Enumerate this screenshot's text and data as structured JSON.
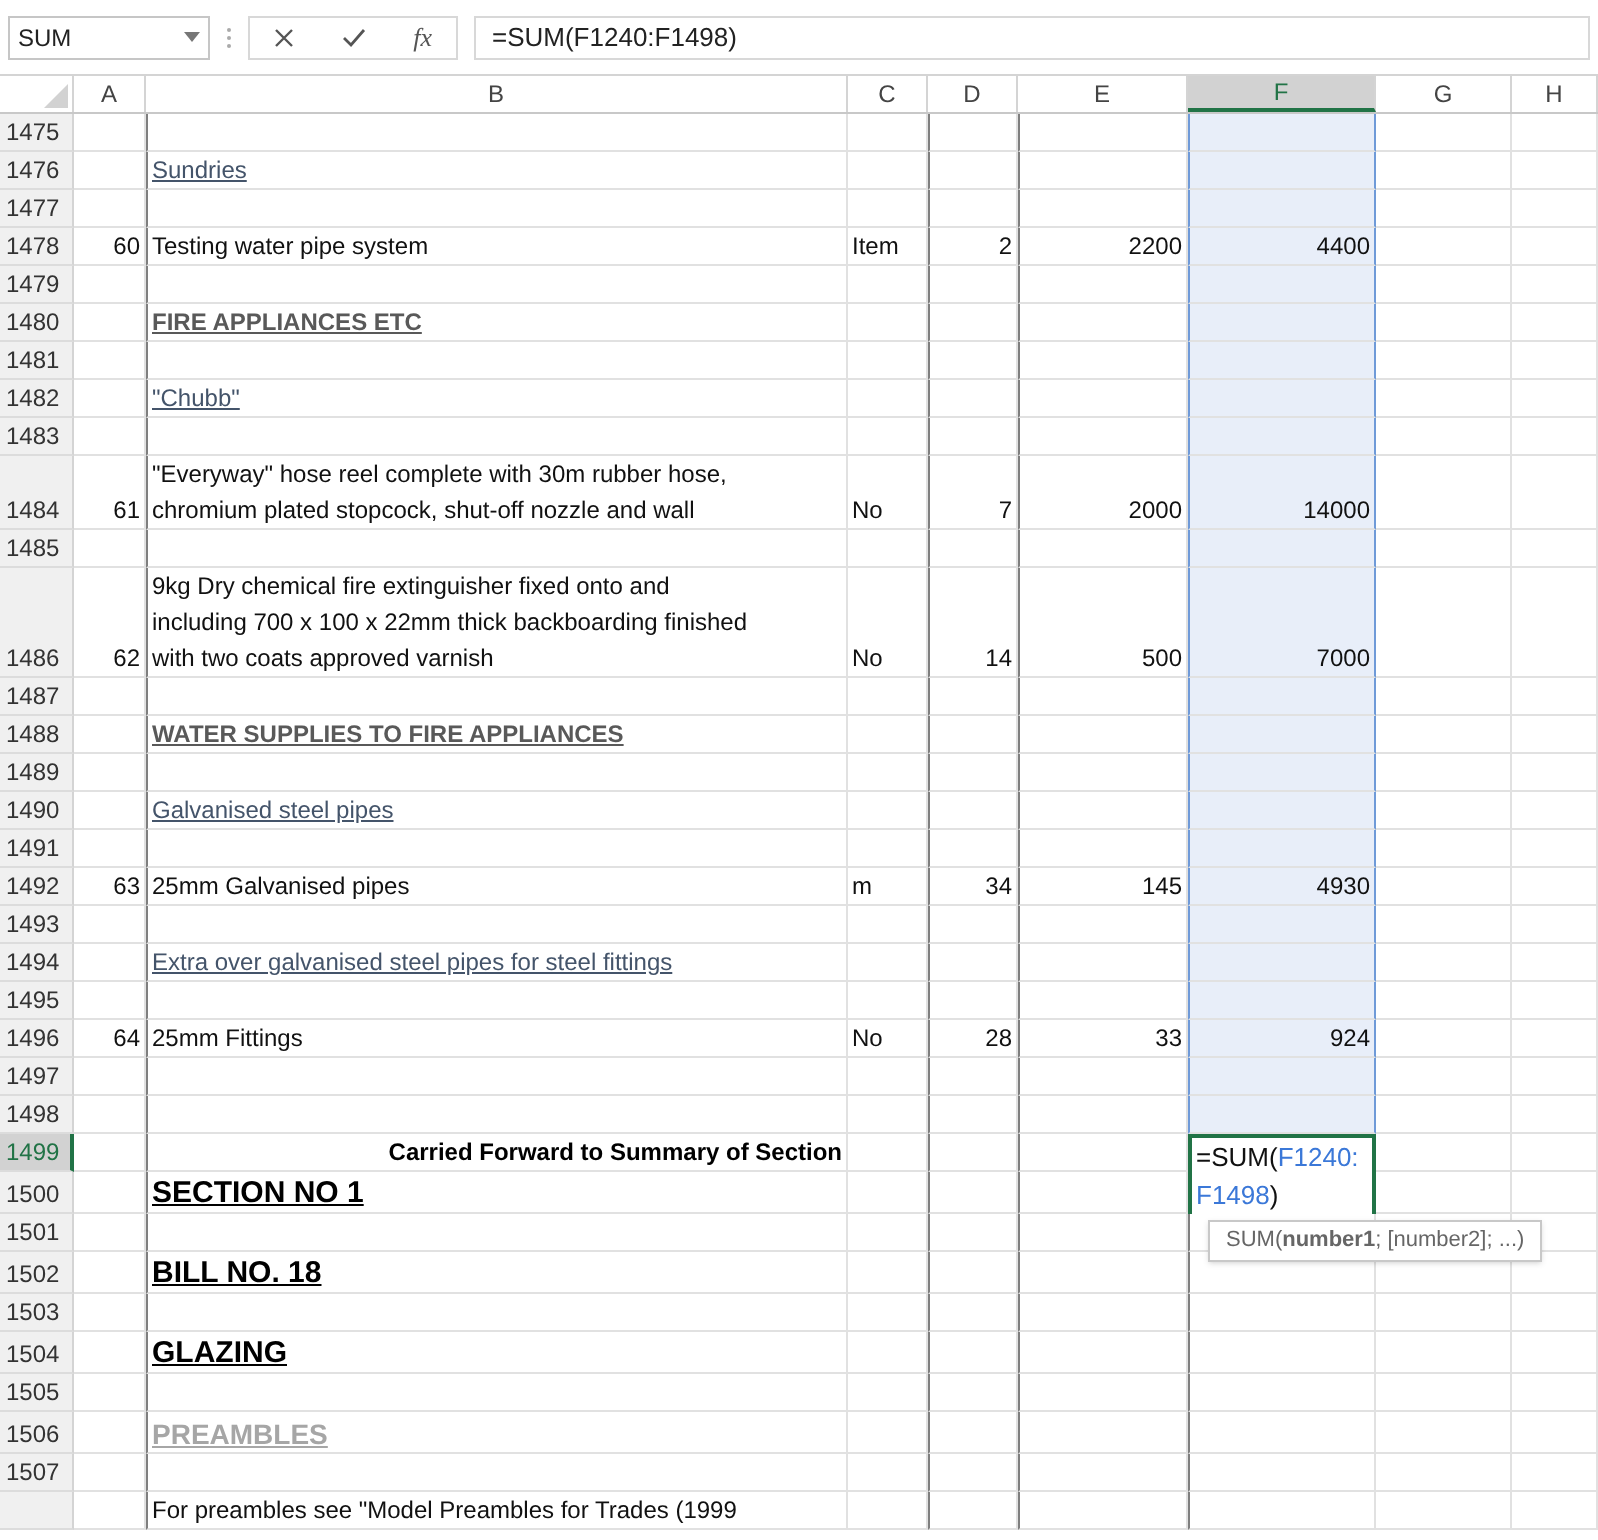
{
  "name_box": "SUM",
  "function_label": "fx",
  "formula": "=SUM(F1240:F1498)",
  "columns": [
    {
      "label": "A",
      "selected": false
    },
    {
      "label": "B",
      "selected": false
    },
    {
      "label": "C",
      "selected": false
    },
    {
      "label": "D",
      "selected": false
    },
    {
      "label": "E",
      "selected": false
    },
    {
      "label": "F",
      "selected": true
    },
    {
      "label": "G",
      "selected": false
    },
    {
      "label": "H",
      "selected": false
    }
  ],
  "rows": [
    {
      "number": "1475",
      "selected": false,
      "in_range": true,
      "kind": "plain"
    },
    {
      "number": "1476",
      "selected": false,
      "in_range": true,
      "kind": "subheading",
      "b": "Sundries"
    },
    {
      "number": "1477",
      "selected": false,
      "in_range": true,
      "kind": "plain"
    },
    {
      "number": "1478",
      "selected": false,
      "in_range": true,
      "kind": "plain",
      "a": "60",
      "b": "Testing water pipe system",
      "c": "Item",
      "d": "2",
      "e": "2200",
      "f": "4400"
    },
    {
      "number": "1479",
      "selected": false,
      "in_range": true,
      "kind": "plain"
    },
    {
      "number": "1480",
      "selected": false,
      "in_range": true,
      "kind": "heading",
      "b": "FIRE APPLIANCES ETC"
    },
    {
      "number": "1481",
      "selected": false,
      "in_range": true,
      "kind": "plain"
    },
    {
      "number": "1482",
      "selected": false,
      "in_range": true,
      "kind": "subheading",
      "b": "\"Chubb\""
    },
    {
      "number": "1483",
      "selected": false,
      "in_range": true,
      "kind": "plain"
    },
    {
      "number": "1484",
      "selected": false,
      "in_range": true,
      "kind": "plain",
      "a": "61",
      "b": "\"Everyway\" hose reel complete with 30m rubber hose,\nchromium plated stopcock, shut-off nozzle and wall",
      "c": "No",
      "d": "7",
      "e": "2000",
      "f": "14000"
    },
    {
      "number": "1485",
      "selected": false,
      "in_range": true,
      "kind": "plain"
    },
    {
      "number": "1486",
      "selected": false,
      "in_range": true,
      "kind": "plain",
      "a": "62",
      "b": "9kg Dry chemical fire extinguisher fixed onto and\nincluding 700 x 100 x 22mm thick backboarding finished\nwith two coats approved varnish",
      "c": "No",
      "d": "14",
      "e": "500",
      "f": "7000"
    },
    {
      "number": "1487",
      "selected": false,
      "in_range": true,
      "kind": "plain"
    },
    {
      "number": "1488",
      "selected": false,
      "in_range": true,
      "kind": "heading",
      "b": "WATER SUPPLIES TO FIRE APPLIANCES"
    },
    {
      "number": "1489",
      "selected": false,
      "in_range": true,
      "kind": "plain"
    },
    {
      "number": "1490",
      "selected": false,
      "in_range": true,
      "kind": "subheading",
      "b": "Galvanised steel pipes"
    },
    {
      "number": "1491",
      "selected": false,
      "in_range": true,
      "kind": "plain"
    },
    {
      "number": "1492",
      "selected": false,
      "in_range": true,
      "kind": "plain",
      "a": "63",
      "b": "25mm Galvanised pipes",
      "c": "m",
      "d": "34",
      "e": "145",
      "f": "4930"
    },
    {
      "number": "1493",
      "selected": false,
      "in_range": true,
      "kind": "plain"
    },
    {
      "number": "1494",
      "selected": false,
      "in_range": true,
      "kind": "subheading",
      "b": "Extra over galvanised steel pipes for steel fittings"
    },
    {
      "number": "1495",
      "selected": false,
      "in_range": true,
      "kind": "plain"
    },
    {
      "number": "1496",
      "selected": false,
      "in_range": true,
      "kind": "plain",
      "a": "64",
      "b": "25mm Fittings",
      "c": "No",
      "d": "28",
      "e": "33",
      "f": "924"
    },
    {
      "number": "1497",
      "selected": false,
      "in_range": true,
      "kind": "plain"
    },
    {
      "number": "1498",
      "selected": false,
      "in_range": true,
      "kind": "plain"
    },
    {
      "number": "1499",
      "selected": true,
      "in_range": false,
      "kind": "total",
      "b": "Carried Forward to Summary of Section"
    },
    {
      "number": "1500",
      "selected": false,
      "kind": "section",
      "b": "SECTION NO 1"
    },
    {
      "number": "1501",
      "selected": false,
      "in_range": false,
      "kind": "plain"
    },
    {
      "number": "1502",
      "selected": false,
      "in_range": false,
      "kind": "section",
      "b": "BILL NO. 18"
    },
    {
      "number": "1503",
      "selected": false,
      "in_range": false,
      "kind": "plain"
    },
    {
      "number": "1504",
      "selected": false,
      "in_range": false,
      "kind": "section",
      "b": "GLAZING"
    },
    {
      "number": "1505",
      "selected": false,
      "in_range": false,
      "kind": "plain"
    },
    {
      "number": "1506",
      "selected": false,
      "in_range": false,
      "kind": "preamble",
      "b": "PREAMBLES"
    },
    {
      "number": "1507",
      "selected": false,
      "in_range": false,
      "kind": "plain"
    },
    {
      "kind": "plain",
      "selected": false,
      "in_range": false,
      "b": "For preambles see \"Model Preambles for Trades (1999"
    }
  ],
  "active_cell": {
    "lines": [
      [
        {
          "text": "=SUM(",
          "kind": "plain"
        },
        {
          "text": "F1240:",
          "kind": "reference"
        }
      ],
      [
        {
          "text": "F1498",
          "kind": "reference"
        },
        {
          "text": ")",
          "kind": "plain"
        }
      ]
    ],
    "tooltip": "SUM(**number1**; [number2]; ...)"
  }
}
